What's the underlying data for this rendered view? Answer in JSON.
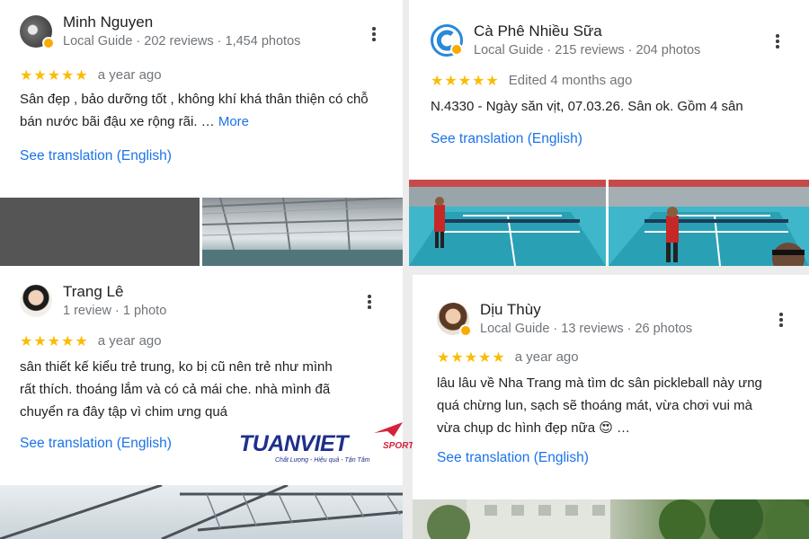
{
  "colors": {
    "link": "#1a73e8",
    "star": "#fbbc04",
    "meta": "#70757a",
    "logo_blue": "#1f2f8c",
    "logo_red": "#d4213d"
  },
  "reviews": [
    {
      "name": "Minh Nguyen",
      "meta": "Local Guide · 202 reviews · 1,454 photos",
      "stars": "★★★★★",
      "time": "a year ago",
      "text": "Sân đẹp , bảo dưỡng tốt , không khí khá thân thiện có chỗ bán nước bãi đậu xe rộng rãi. …",
      "more": "More",
      "translate": "See translation (English)",
      "menu_icon": "more-vert-icon"
    },
    {
      "name": "Cà Phê Nhiều Sữa",
      "meta": "Local Guide · 215 reviews · 204 photos",
      "stars": "★★★★★",
      "time": "Edited 4 months ago",
      "text": "N.4330 - Ngày săn vịt, 07.03.26. Sân ok. Gồm 4 sân",
      "translate": "See translation (English)",
      "menu_icon": "more-vert-icon"
    },
    {
      "name": "Trang Lê",
      "meta": "1 review · 1 photo",
      "stars": "★★★★★",
      "time": "a year ago",
      "text_lines": [
        "sân thiết kế kiểu trẻ trung, ko bị cũ nên trẻ như mình",
        "rất thích. thoáng lắm và có cả mái che. nhà mình đã",
        "chuyển ra đây tập vì chim ưng quá"
      ],
      "translate": "See translation (English)",
      "menu_icon": "more-vert-icon"
    },
    {
      "name": "Dịu Thùy",
      "meta": "Local Guide · 13 reviews · 26 photos",
      "stars": "★★★★★",
      "time": "a year ago",
      "text_lines": [
        "lâu lâu về Nha Trang mà tìm dc sân pickleball này ưng",
        "quá chừng lun, sạch sẽ thoáng mát, vừa chơi vui mà",
        "vừa chụp dc hình đẹp nữa 😍 …"
      ],
      "translate": "See translation (English)",
      "menu_icon": "more-vert-icon"
    }
  ],
  "watermark": {
    "brand": "TUANVIET",
    "sport": "SPORT™",
    "tagline": "Chất Lượng - Hiệu quả - Tận Tâm"
  }
}
